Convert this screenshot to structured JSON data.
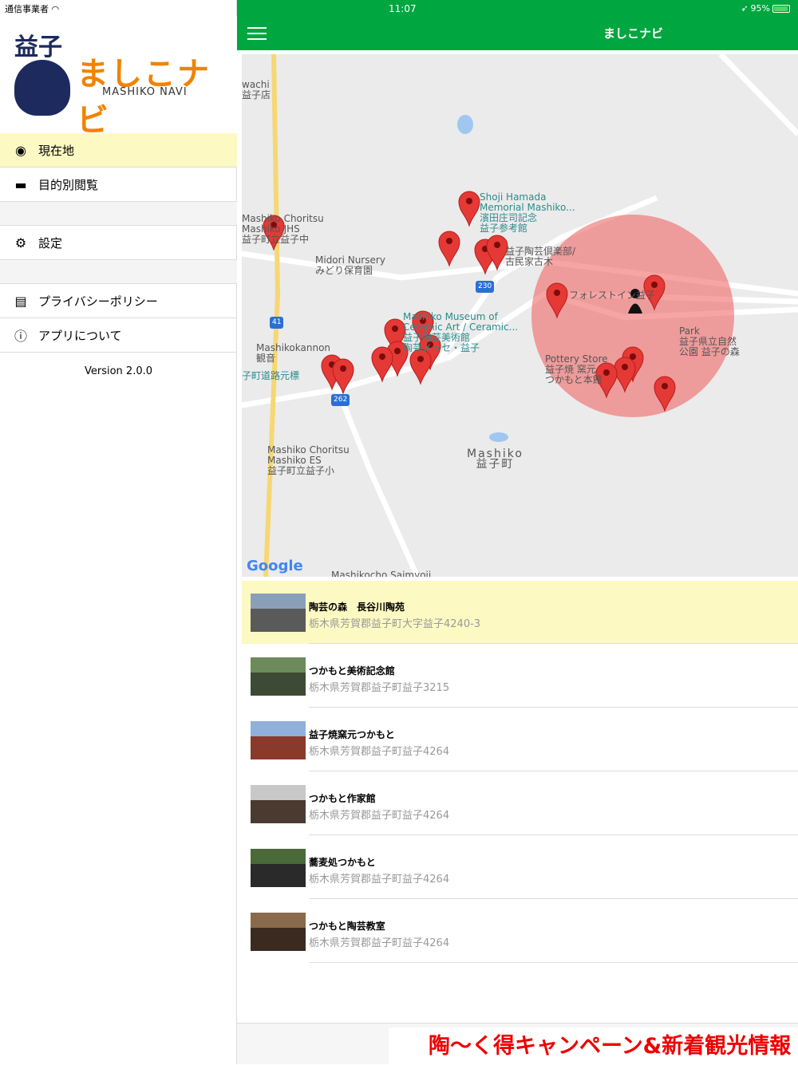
{
  "status": {
    "carrier": "通信事業者",
    "time": "11:07",
    "battery": "95%"
  },
  "sidebar": {
    "logo": {
      "kanji": "益子",
      "title": "ましこナビ",
      "subtitle": "MASHIKO NAVI"
    },
    "items": [
      {
        "label": "現在地",
        "icon": "location-icon"
      },
      {
        "label": "目的別閲覧",
        "icon": "folder-icon"
      },
      {
        "label": "設定",
        "icon": "gear-icon"
      },
      {
        "label": "プライバシーポリシー",
        "icon": "document-icon"
      },
      {
        "label": "アプリについて",
        "icon": "info-icon"
      }
    ],
    "version": "Version 2.0.0"
  },
  "header": {
    "title": "ましこナビ"
  },
  "map": {
    "labels": [
      "Shoji Hamada\nMemorial Mashiko...\n濱田庄司記念\n益子参考館",
      "Mashiko Choritsu\nMashiko JHS\n益子町立益子中",
      "Midori Nursery\nみどり保育園",
      "Mashiko Museum of\nCeramic Art / Ceramic...\n益子陶芸美術館\n陶芸メッセ・益子",
      "Mashikokannon\n観音",
      "子町道路元標",
      "益子陶芸倶楽部/\n古民家古木",
      "フォレストイン益子",
      "Park\n益子県立自然\n公園 益子の森",
      "Pottery Store\n益子焼 窯元\nつかもと本館",
      "Mashiko Choritsu\nMashiko ES\n益子町立益子小",
      "Mashiko\n益子町",
      "wachi\n益子店",
      "Mashikocho Saimyoji",
      "230",
      "41",
      "262"
    ],
    "attribution": "Google"
  },
  "list": [
    {
      "name": "陶芸の森　長谷川陶苑",
      "address": "栃木県芳賀郡益子町大字益子4240-3",
      "selected": true
    },
    {
      "name": "つかもと美術記念館",
      "address": "栃木県芳賀郡益子町益子3215"
    },
    {
      "name": "益子焼窯元つかもと",
      "address": "栃木県芳賀郡益子町益子4264"
    },
    {
      "name": "つかもと作家館",
      "address": "栃木県芳賀郡益子町益子4264"
    },
    {
      "name": "蕎麦処つかもと",
      "address": "栃木県芳賀郡益子町益子4264"
    },
    {
      "name": "つかもと陶芸教室",
      "address": "栃木県芳賀郡益子町益子4264"
    }
  ],
  "banner": {
    "text": "陶〜く得キャンペーン&新着観光情報"
  },
  "colors": {
    "header": "#00a63f",
    "selected": "#fdf9c2",
    "logo": "#f08300",
    "banner": "#ee0000",
    "pin": "#e53935"
  }
}
